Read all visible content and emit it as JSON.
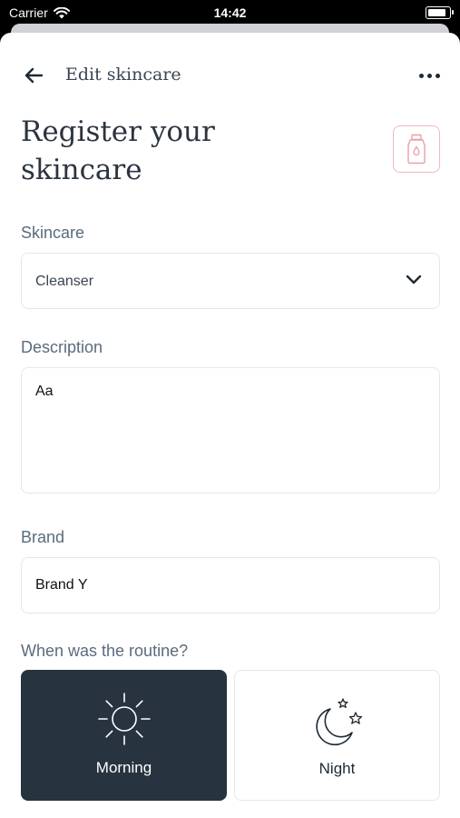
{
  "status_bar": {
    "carrier": "Carrier",
    "time": "14:42",
    "battery_level": 1.0
  },
  "navbar": {
    "title": "Edit skincare",
    "back_icon": "arrow-left-icon",
    "more_icon": "more-horizontal-icon"
  },
  "header": {
    "title": "Register your skincare",
    "product_icon": "cleanser-bottle-icon",
    "accent_color": "#f2b8bf"
  },
  "form": {
    "skincare": {
      "label": "Skincare",
      "value": "Cleanser"
    },
    "description": {
      "label": "Description",
      "placeholder": "Aa"
    },
    "brand": {
      "label": "Brand",
      "value": "Brand Y"
    },
    "routine": {
      "label": "When was the routine?",
      "options": [
        {
          "label": "Morning",
          "icon": "sun-icon",
          "selected": true
        },
        {
          "label": "Night",
          "icon": "moon-stars-icon",
          "selected": false
        }
      ]
    }
  },
  "colors": {
    "selected_card": "#27333f",
    "label_text": "#5b6b7d",
    "border": "#e4e7eb"
  }
}
